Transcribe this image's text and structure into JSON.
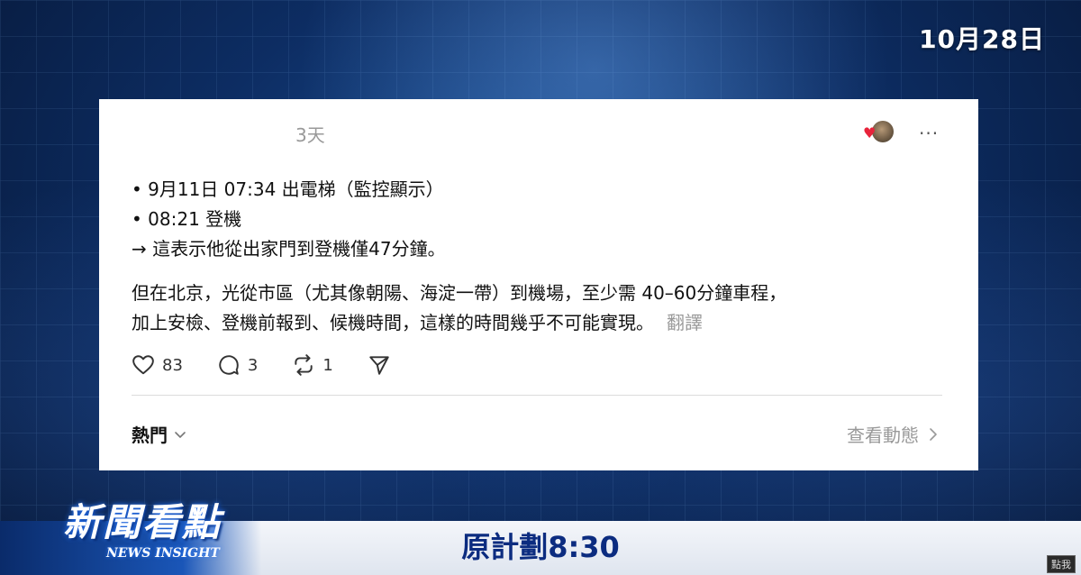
{
  "date": "10月28日",
  "post": {
    "time_ago": "3天",
    "more": "···",
    "lines": [
      "• 9月11日 07:34 出電梯（監控顯示）",
      "• 08:21 登機",
      "→ 這表示他從出家門到登機僅47分鐘。"
    ],
    "para2_line1": "但在北京，光從市區（尤其像朝陽、海淀一帶）到機場，至少需 40–60分鐘車程，",
    "para2_line2": "加上安檢、登機前報到、候機時間，這樣的時間幾乎不可能實現。",
    "translate": "翻譯",
    "likes": "83",
    "comments": "3",
    "reposts": "1",
    "sort_label": "熱門",
    "view_activity": "查看動態"
  },
  "banner": {
    "subtitle": "原計劃8:30",
    "logo_main": "新聞看點",
    "logo_sub": "NEWS INSIGHT"
  },
  "corner_tag": "點我",
  "icons": {
    "like": "heart-icon",
    "comment": "comment-bubble-icon",
    "repost": "repost-icon",
    "share": "send-icon",
    "sort": "chevron-down-icon",
    "activity": "chevron-right-icon",
    "badge": "heart-badge-icon"
  },
  "colors": {
    "heart_badge": "#e8233b",
    "subtitle": "#0c2c80",
    "muted": "#999999"
  }
}
